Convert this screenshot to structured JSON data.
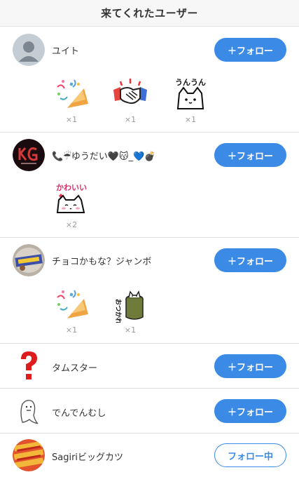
{
  "header": {
    "title": "来てくれたユーザー"
  },
  "users": [
    {
      "name": "ユイト",
      "follow_label": "＋フォロー",
      "stamps": [
        {
          "icon": "party-popper-stamp-icon",
          "count": "×1"
        },
        {
          "icon": "handshake-stamp-icon",
          "count": "×1"
        },
        {
          "icon": "unun-cat-stamp-icon",
          "count": "×1",
          "caption": "うんうん"
        }
      ]
    },
    {
      "name": "📞☔ゆうだい🖤😽_💙💣",
      "follow_label": "＋フォロー",
      "stamps": [
        {
          "icon": "kawaii-cat-stamp-icon",
          "count": "×2",
          "caption": "かわいい"
        }
      ]
    },
    {
      "name": "チョコかもな？ジャンボ",
      "follow_label": "＋フォロー",
      "stamps": [
        {
          "icon": "party-popper-stamp-icon",
          "count": "×1"
        },
        {
          "icon": "otsukare-cat-stamp-icon",
          "count": "×1",
          "caption": "おつかれ さま"
        }
      ]
    },
    {
      "name": "タムスター",
      "follow_label": "＋フォロー",
      "stamps": []
    },
    {
      "name": "でんでんむし",
      "follow_label": "＋フォロー",
      "stamps": []
    },
    {
      "name": "Sagiriビッグカツ",
      "follow_label": "フォロー中",
      "stamps": []
    }
  ],
  "colors": {
    "accent": "#3b8ae6",
    "divider": "#e0e0e0",
    "count_text": "#999999"
  }
}
